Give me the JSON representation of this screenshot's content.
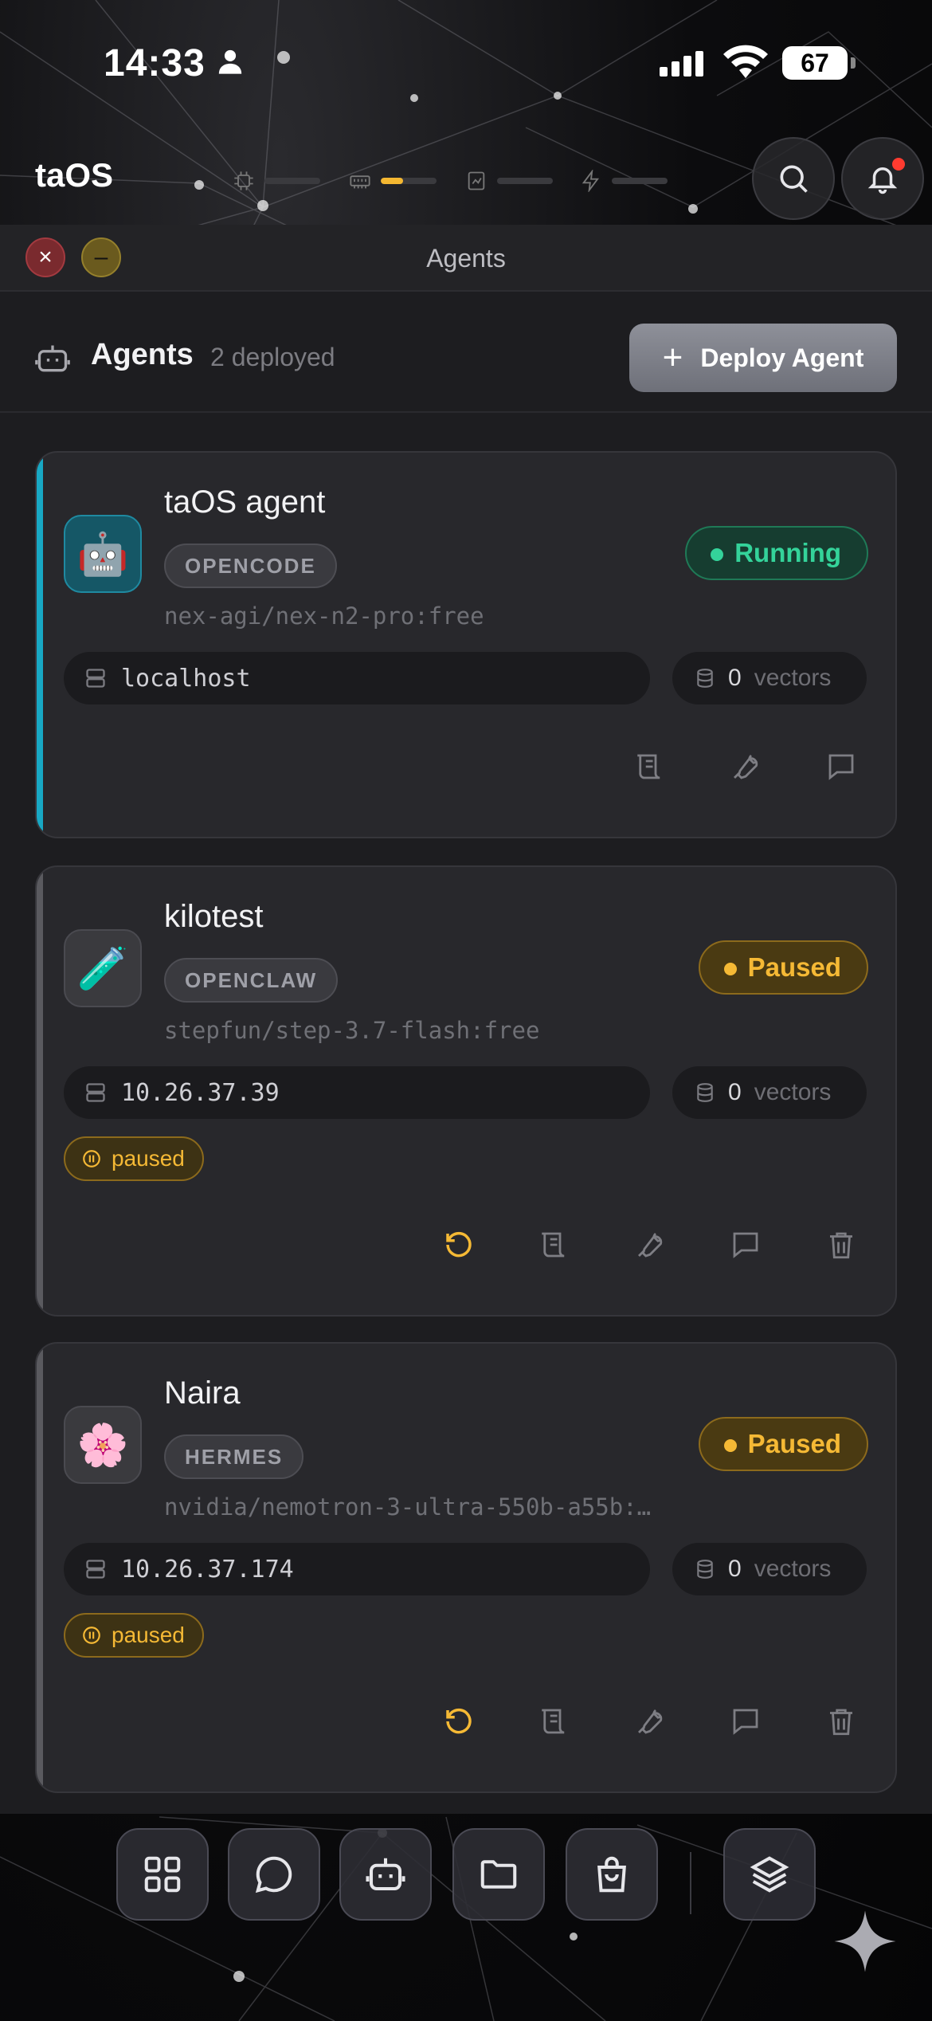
{
  "status_bar": {
    "time": "14:33",
    "battery": "67"
  },
  "topbar": {
    "brand": "taOS",
    "meters": [
      {
        "icon": "cpu-icon",
        "level": 0
      },
      {
        "icon": "memory-icon",
        "level": 0.4
      },
      {
        "icon": "storage-icon",
        "level": 0
      },
      {
        "icon": "power-icon",
        "level": 0
      }
    ]
  },
  "window": {
    "title": "Agents",
    "header": {
      "title": "Agents",
      "subtitle": "2 deployed",
      "deploy_label": "Deploy Agent"
    },
    "agents": [
      {
        "name": "taOS agent",
        "avatar": "🤖",
        "framework": "OPENCODE",
        "model": "nex-agi/nex-n2-pro:free",
        "status": "Running",
        "host": "localhost",
        "vectors": "0",
        "vectors_label": "vectors"
      },
      {
        "name": "kilotest",
        "avatar": "🧪",
        "framework": "OPENCLAW",
        "model": "stepfun/step-3.7-flash:free",
        "status": "Paused",
        "host": "10.26.37.39",
        "vectors": "0",
        "vectors_label": "vectors",
        "tag": "paused"
      },
      {
        "name": "Naira",
        "avatar": "🌸",
        "framework": "HERMES",
        "model": "nvidia/nemotron-3-ultra-550b-a55b:…",
        "status": "Paused",
        "host": "10.26.37.174",
        "vectors": "0",
        "vectors_label": "vectors",
        "tag": "paused"
      }
    ]
  },
  "dock": {
    "items": [
      "apps-grid-icon",
      "chat-icon",
      "agents-icon",
      "folder-icon",
      "store-bag-icon",
      "layers-icon"
    ]
  },
  "colors": {
    "running": "#34d39a",
    "paused": "#f5b935",
    "accent_cyan": "#18a8c4"
  }
}
